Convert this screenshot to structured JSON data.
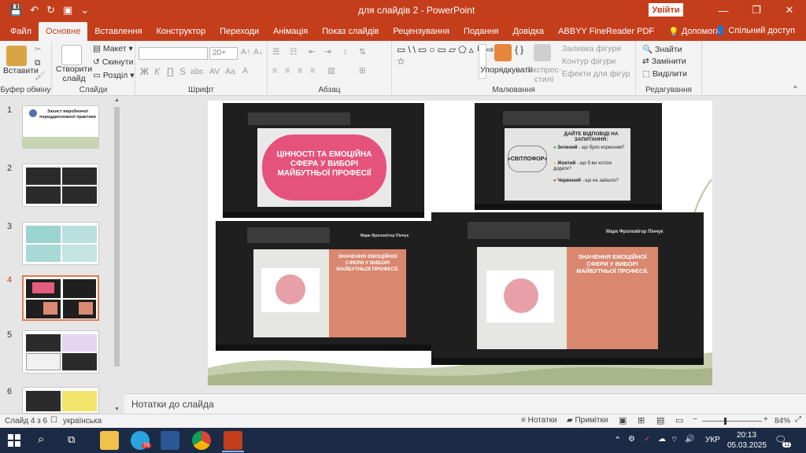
{
  "window": {
    "title": "для слайдів 2  -  PowerPoint",
    "signin_label": "Увійти",
    "minimize": "—",
    "restore": "❐",
    "close": "✕"
  },
  "qat": {
    "save": "💾",
    "undo": "↶",
    "redo": "↻",
    "present": "▣",
    "more": "⌄"
  },
  "tabs": [
    "Файл",
    "Основне",
    "Вставлення",
    "Конструктор",
    "Переходи",
    "Анімація",
    "Показ слайдів",
    "Рецензування",
    "Подання",
    "Довідка",
    "ABBYY FineReader PDF",
    "Допомога"
  ],
  "share_label": "Спільний доступ",
  "ribbon": {
    "clipboard": {
      "paste": "Вставити",
      "label": "Буфер обміну"
    },
    "slides": {
      "new_slide": "Створити слайд",
      "layout": "Макет",
      "reset": "Скинути",
      "section": "Розділ",
      "label": "Слайди"
    },
    "font": {
      "size": "20+",
      "bold": "Ж",
      "italic": "К",
      "underline": "П",
      "strike": "S",
      "shadow": "abc",
      "label": "Шрифт"
    },
    "paragraph": {
      "label": "Абзац"
    },
    "drawing": {
      "arrange": "Упорядкувати",
      "quick_styles": "Експрес-стилі",
      "fill": "Заливка фігури",
      "outline": "Контур фігури",
      "effects": "Ефекти для фігур",
      "label": "Малювання"
    },
    "editing": {
      "find": "Знайти",
      "replace": "Замінити",
      "select": "Виділити",
      "label": "Редагування"
    }
  },
  "thumbnails": [
    {
      "num": "1",
      "caption": "Захист виробничої переддипломної практики"
    },
    {
      "num": "2",
      "caption": ""
    },
    {
      "num": "3",
      "caption": ""
    },
    {
      "num": "4",
      "caption": ""
    },
    {
      "num": "5",
      "caption": ""
    },
    {
      "num": "6",
      "caption": ""
    }
  ],
  "slide": {
    "shot1_title": "ЦІННОСТІ ТА ЕМОЦІЙНА СФЕРА У ВИБОРІ МАЙБУТНЬОЇ ПРОФЕСІЇ",
    "shot2_heading": "ДАЙТЕ ВІДПОВІДІ НА ЗАПИТАННЯ:",
    "shot2_label": "«СВІТЛОФОР»",
    "shot2_green": "Зелений",
    "shot2_green_q": " - що було корисним?",
    "shot2_yellow": "Жовтий",
    "shot2_yellow_q": " - що б ви хотіли додати?",
    "shot2_red": "Червоний",
    "shot2_red_q": " - що не зайшло?",
    "shot3_title": "ЗНАЧЕННЯ ЕМОЦІЙНОЇ СФЕРИ У ВИБОРІ МАЙБУТНЬОЇ ПРОФЕСІЇ.",
    "shot4_title": "ЗНАЧЕННЯ ЕМОЦІЙНОЇ СФЕРИ У ВИБОРІ МАЙБУТНЬОЇ ПРОФЕСІЇ.",
    "participant_a": "Марк Фролов",
    "participant_b": "Ігор Пінчук"
  },
  "notes_placeholder": "Нотатки до слайда",
  "status": {
    "slide_count": "Слайд 4 з 6",
    "language": "українська",
    "notes_btn": "Нотатки",
    "comments_btn": "Примітки",
    "zoom": "84%"
  },
  "taskbar": {
    "lang": "УКР",
    "time": "20:13",
    "date": "05.03.2025",
    "notif_count": "11",
    "telegram_badge": "74"
  }
}
